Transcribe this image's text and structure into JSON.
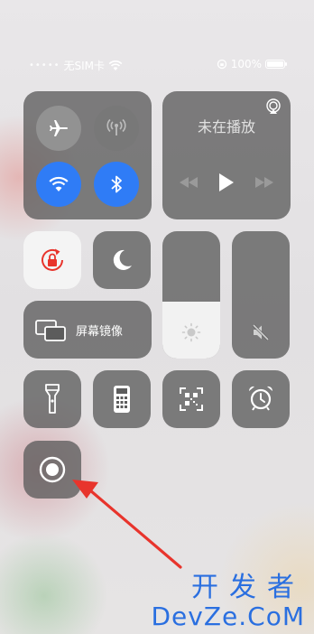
{
  "status_bar": {
    "carrier_dots": "•••••",
    "carrier": "无SIM卡",
    "battery_percent": "100%",
    "battery_level": 1.0
  },
  "connectivity": {
    "airplane_icon": "airplane-icon",
    "cellular_icon": "cellular-antenna-icon",
    "wifi_icon": "wifi-icon",
    "bluetooth_icon": "bluetooth-icon",
    "wifi_active": true,
    "bluetooth_active": true
  },
  "music": {
    "status": "未在播放",
    "airplay_icon": "airplay-icon"
  },
  "screen_mirroring": {
    "label": "屏幕镜像"
  },
  "brightness": {
    "level": 0.45,
    "icon": "sun-icon"
  },
  "volume": {
    "level": 0.0,
    "icon": "speaker-muted-icon"
  },
  "bottom_row": [
    "flashlight-icon",
    "calculator-icon",
    "qr-scanner-icon",
    "alarm-clock-icon"
  ],
  "screen_recording": {
    "icon": "record-icon"
  },
  "watermark": {
    "line1": "开发者",
    "line2": "DevZe.CoM"
  },
  "colors": {
    "accent_blue": "#2f7cf6",
    "annotation_red": "#e8342c",
    "watermark_blue": "#2a6fe0"
  }
}
